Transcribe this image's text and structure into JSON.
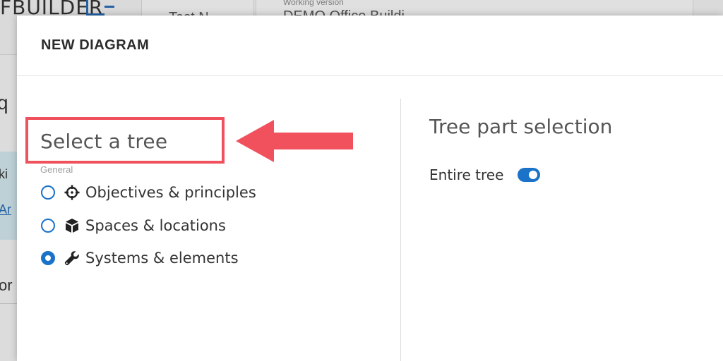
{
  "background": {
    "logo_text": "FBUILDER",
    "tab_text": "Test N",
    "working_version_label": "Working version",
    "working_version_value": "DEMO Office Buildi",
    "side_heading": "q",
    "side_text_1": "ki",
    "side_link": "Ar",
    "side_text_2": "or"
  },
  "modal": {
    "title": "NEW DIAGRAM",
    "left": {
      "heading": "Select a tree",
      "group_label": "General",
      "options": [
        {
          "label": "Objectives & principles",
          "icon": "crosshair-icon",
          "checked": false
        },
        {
          "label": "Spaces & locations",
          "icon": "cube-icon",
          "checked": false
        },
        {
          "label": "Systems & elements",
          "icon": "wrench-icon",
          "checked": true
        }
      ]
    },
    "right": {
      "heading": "Tree part selection",
      "entire_tree_label": "Entire tree",
      "entire_tree_on": true
    }
  },
  "annotation": {
    "highlight_color": "#f0515d",
    "arrow_color": "#f0515d"
  },
  "colors": {
    "accent": "#1a73c9"
  }
}
